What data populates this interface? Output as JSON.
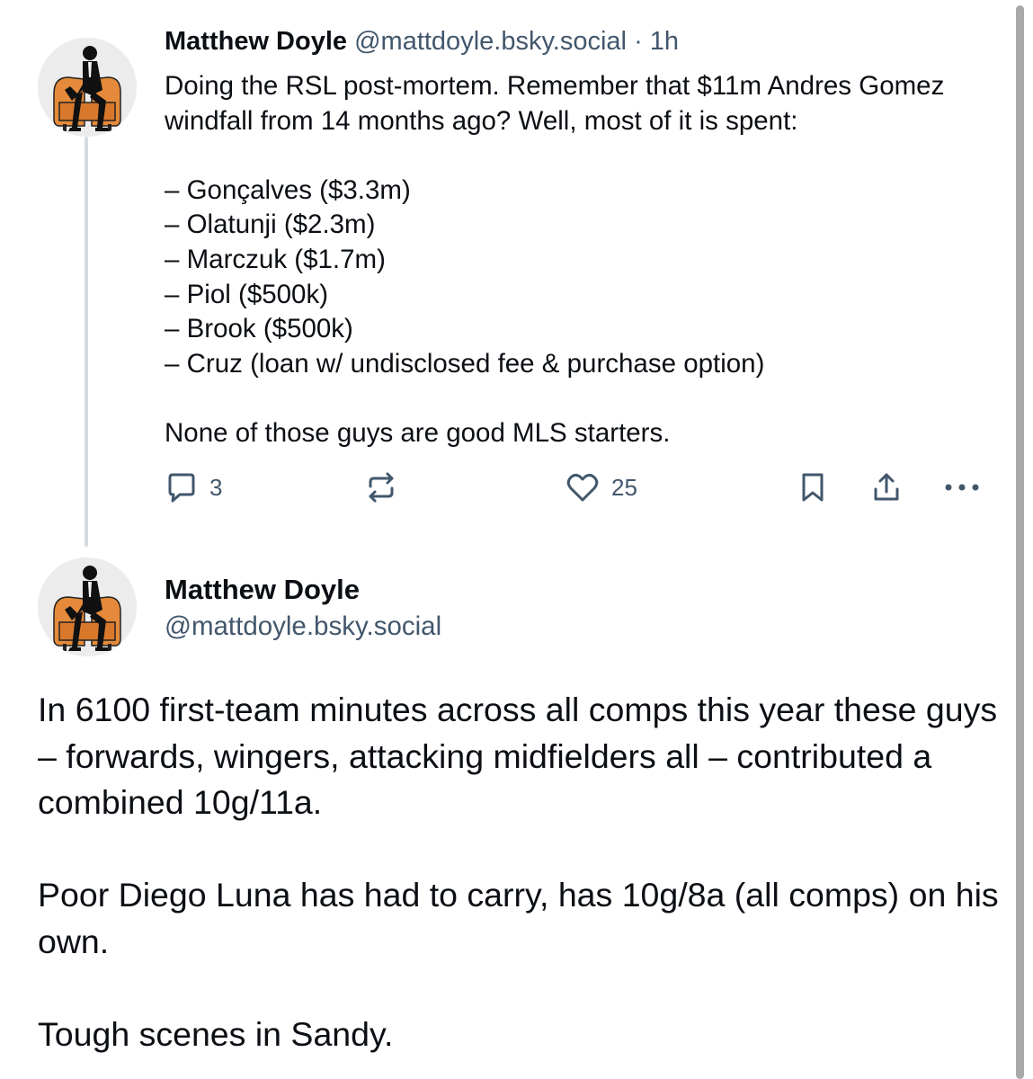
{
  "post1": {
    "author_name": "Matthew Doyle",
    "author_handle": "@mattdoyle.bsky.social",
    "separator": "·",
    "time_ago": "1h",
    "paragraphs": [
      "Doing the RSL post-mortem. Remember that $11m Andres Gomez windfall from 14 months ago? Well, most of it is spent:"
    ],
    "list": [
      "– Gonçalves ($3.3m)",
      "– Olatunji ($2.3m)",
      "– Marczuk ($1.7m)",
      "– Piol ($500k)",
      "– Brook ($500k)",
      "– Cruz (loan w/ undisclosed fee & purchase option)"
    ],
    "closing": "None of those guys are good MLS starters.",
    "actions": {
      "reply_count": "3",
      "like_count": "25",
      "reply_icon": "speech-bubble-icon",
      "repost_icon": "repost-arrows-icon",
      "like_icon": "heart-icon",
      "bookmark_icon": "bookmark-icon",
      "share_icon": "share-upload-icon",
      "more_icon": "ellipsis-icon"
    }
  },
  "post2": {
    "author_name": "Matthew Doyle",
    "author_handle": "@mattdoyle.bsky.social",
    "paragraphs": [
      "In 6100 first-team minutes across all comps this year these guys – forwards, wingers, attacking midfielders all – contributed a combined 10g/11a.",
      "Poor Diego Luna has had to carry, has 10g/8a (all comps) on his own.",
      "Tough scenes in Sandy."
    ]
  },
  "colors": {
    "text": "#0b0f14",
    "muted": "#42576c",
    "thread_line": "#d6dbe0",
    "avatar_chair": "#e58a3a"
  }
}
